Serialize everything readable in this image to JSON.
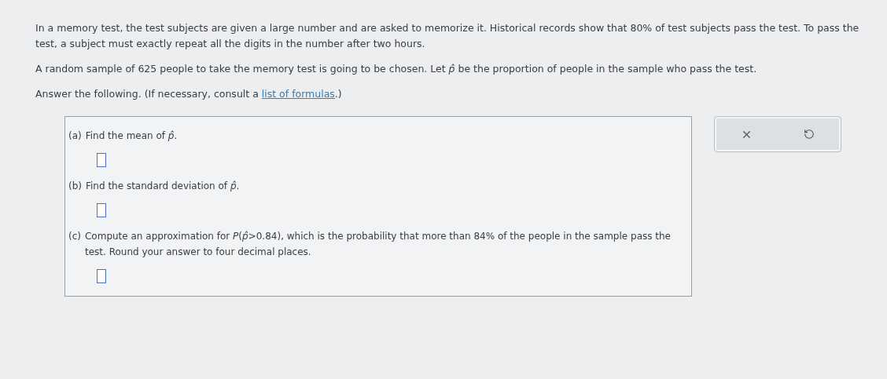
{
  "intro": [
    {
      "text": "In a memory test, the test subjects are given a large number and are asked to memorize it. Historical records show that 80% of test subjects pass the test. To pass the test, a subject must exactly repeat all the digits in the number after two hours."
    },
    {
      "text": "A random sample of 625 people to take the memory test is going to be chosen. Let *p̂* be the proportion of people in the sample who pass the test."
    }
  ],
  "instruction": {
    "before": "Answer the following. (If necessary, consult a ",
    "link": "list of formulas",
    "after": ".)"
  },
  "parts": [
    {
      "label": "(a)",
      "text": "Find the mean of *p̂*."
    },
    {
      "label": "(b)",
      "text": "Find the standard deviation of *p̂*."
    },
    {
      "label": "(c)",
      "text": "Compute an approximation for *P*(*p̂*>0.84), which is the probability that more than 84% of the people in the sample pass the test. Round your answer to four decimal places."
    }
  ]
}
